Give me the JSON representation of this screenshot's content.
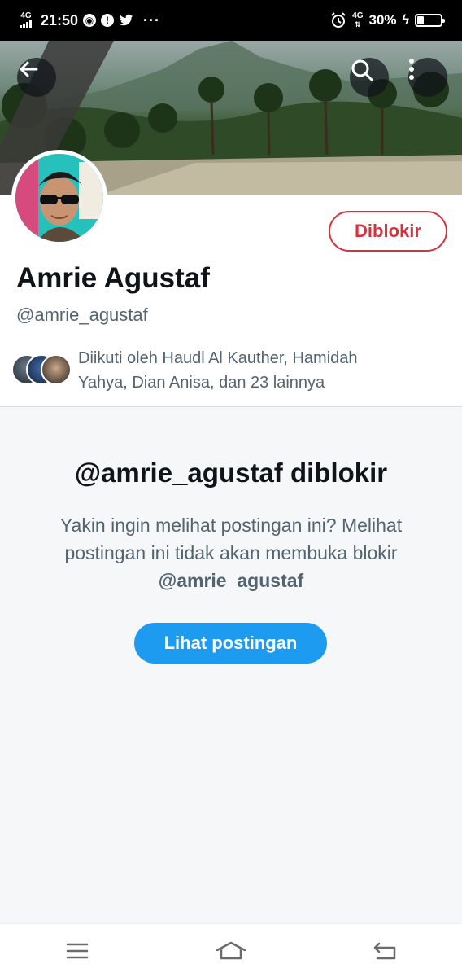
{
  "status_bar": {
    "network": "4G",
    "time": "21:50",
    "notification_icons": [
      "chrome-icon",
      "alert-icon",
      "twitter-icon"
    ],
    "more": "···",
    "right_network": "4G",
    "battery_percent": "30%",
    "battery_level": 0.3
  },
  "header": {
    "back_icon": "back-arrow-icon",
    "search_icon": "search-icon",
    "more_icon": "more-vertical-icon"
  },
  "profile": {
    "name": "Amrie Agustaf",
    "handle": "@amrie_agustaf",
    "blocked_button_label": "Diblokir",
    "followed_by_line1": "Diikuti oleh Haudl Al Kauther, Hamidah",
    "followed_by_line2": "Yahya, Dian Anisa, dan 23 lainnya"
  },
  "blocked_notice": {
    "title": "@amrie_agustaf diblokir",
    "desc_prefix": "Yakin ingin melihat postingan ini? Melihat postingan ini tidak akan membuka blokir ",
    "desc_handle": "@amrie_agustaf",
    "view_button_label": "Lihat postingan"
  },
  "nav_bar": {
    "items": [
      "menu-icon",
      "home-icon",
      "back-icon"
    ]
  },
  "colors": {
    "blocked_red": "#dc2f3c",
    "primary_blue": "#1d9bf0",
    "secondary_text": "#536471",
    "primary_text": "#0f1419"
  }
}
